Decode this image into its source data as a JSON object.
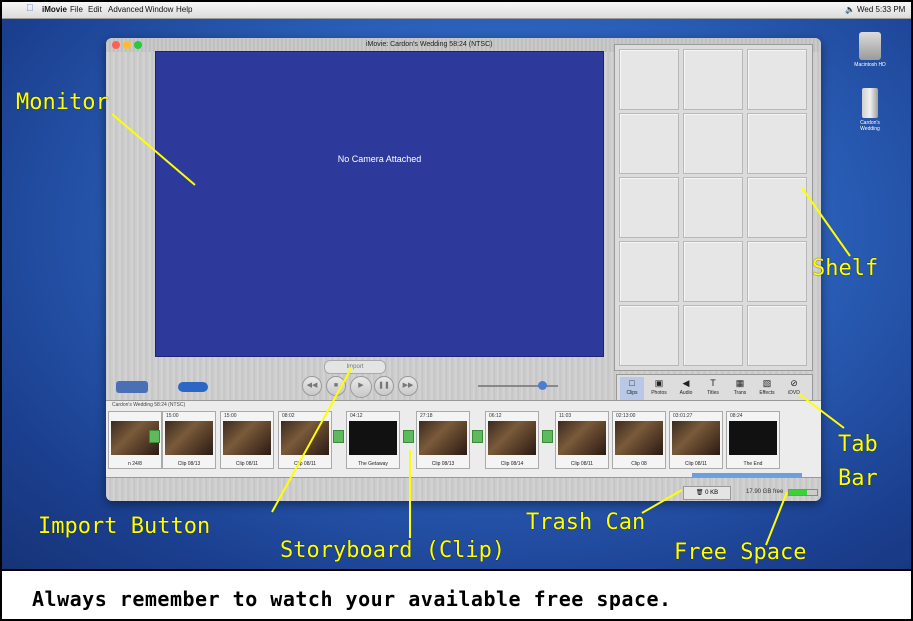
{
  "menubar": {
    "app_name": "iMovie",
    "items": [
      "File",
      "Edit",
      "Advanced",
      "Window",
      "Help"
    ],
    "clock": "Wed 5:33 PM"
  },
  "window": {
    "title": "iMovie: Cardon's Wedding  58:24 (NTSC)",
    "traffic_lights": [
      "#ff5f57",
      "#ffbd2e",
      "#28c840"
    ]
  },
  "monitor": {
    "status": "No Camera Attached"
  },
  "import_button": {
    "label": "Import"
  },
  "controls": {
    "transport": [
      "rewind-icon",
      "stop-icon",
      "play-icon",
      "pause-icon",
      "fast-forward-icon"
    ]
  },
  "tabs": [
    {
      "label": "Clips",
      "icon": "film-icon"
    },
    {
      "label": "Photos",
      "icon": "camera-icon"
    },
    {
      "label": "Audio",
      "icon": "speaker-icon"
    },
    {
      "label": "Titles",
      "icon": "text-icon"
    },
    {
      "label": "Trans",
      "icon": "transition-icon"
    },
    {
      "label": "Effects",
      "icon": "effects-icon"
    },
    {
      "label": "iDVD",
      "icon": "dvd-icon"
    }
  ],
  "storyboard": {
    "project_label": "Cardon's Wedding  58:24 (NTSC)",
    "clips": [
      {
        "time": "",
        "label": "n 24/8"
      },
      {
        "time": "15:00",
        "label": "Clip 08/13"
      },
      {
        "time": "15:00",
        "label": "Clip 08/11"
      },
      {
        "time": "08:02",
        "label": "Clip 08/11"
      },
      {
        "time": "04:12",
        "label": "The Getaway"
      },
      {
        "time": "27:18",
        "label": "Clip 08/13"
      },
      {
        "time": "06:12",
        "label": "Clip 08/14"
      },
      {
        "time": "11:03",
        "label": "Clip 08/11"
      },
      {
        "time": "02:13:00",
        "label": "Clip 08"
      },
      {
        "time": "03:01:27",
        "label": "Clip 08/11"
      },
      {
        "time": "08:24",
        "label": "The End"
      }
    ]
  },
  "trash": {
    "label": "0 KB"
  },
  "free_space": {
    "label": "17.90 GB free",
    "fraction": 0.65
  },
  "desktop_icons": [
    "Macintosh HD",
    "Cardon's Wedding"
  ],
  "annotations": {
    "monitor": "Monitor",
    "shelf": "Shelf",
    "tab_bar_1": "Tab",
    "tab_bar_2": "Bar",
    "import_button": "Import Button",
    "storyboard": "Storyboard (Clip)",
    "trash_can": "Trash Can",
    "free_space": "Free Space",
    "caption": "Always remember to watch your available free space."
  }
}
